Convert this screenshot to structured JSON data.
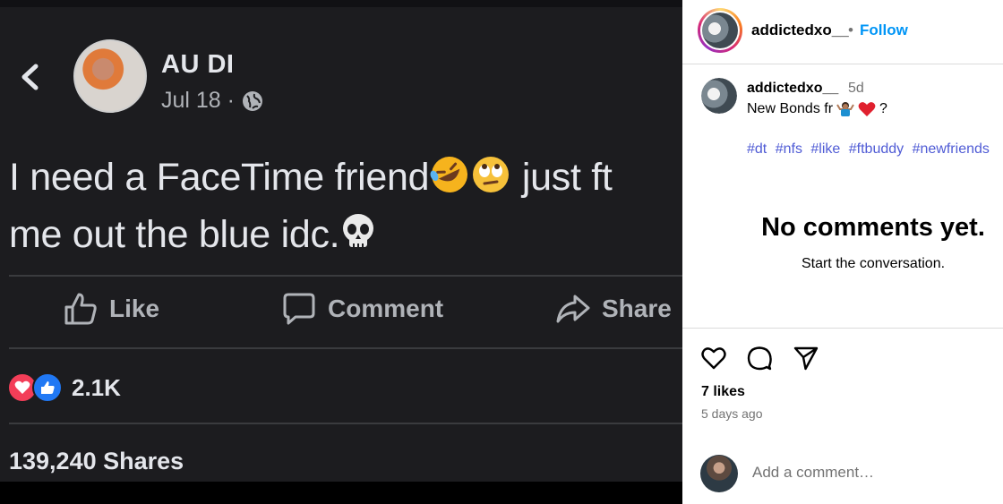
{
  "post_image": {
    "author": "AU DI",
    "date": "Jul 18 ·",
    "text_line1": "I need a FaceTime friend",
    "text_mid": "just ft",
    "text_line2": "me out the blue idc.",
    "actions": {
      "like": "Like",
      "comment": "Comment",
      "share": "Share"
    },
    "reaction_count": "2.1K",
    "shares": "139,240 Shares"
  },
  "instagram": {
    "username": "addictedxo__",
    "dot": "•",
    "follow_label": "Follow",
    "caption": {
      "username": "addictedxo__",
      "time": "5d",
      "text": "New Bonds fr",
      "suffix": "?"
    },
    "hashtags": [
      "#dt",
      "#nfs",
      "#like",
      "#ftbuddy",
      "#newfriends"
    ],
    "no_comments_title": "No comments yet.",
    "no_comments_sub": "Start the conversation.",
    "likes": "7 likes",
    "time_ago": "5 days ago",
    "comment_placeholder": "Add a comment…"
  },
  "colors": {
    "follow": "#0095f6",
    "hashtag": "#4f5bd5",
    "fb_bg": "#1c1c1f"
  },
  "icons": [
    "back-chevron-icon",
    "globe-icon",
    "like-thumb-icon",
    "comment-bubble-icon",
    "share-arrow-icon",
    "love-reaction-icon",
    "like-reaction-icon",
    "heart-icon",
    "comment-icon",
    "send-icon"
  ]
}
